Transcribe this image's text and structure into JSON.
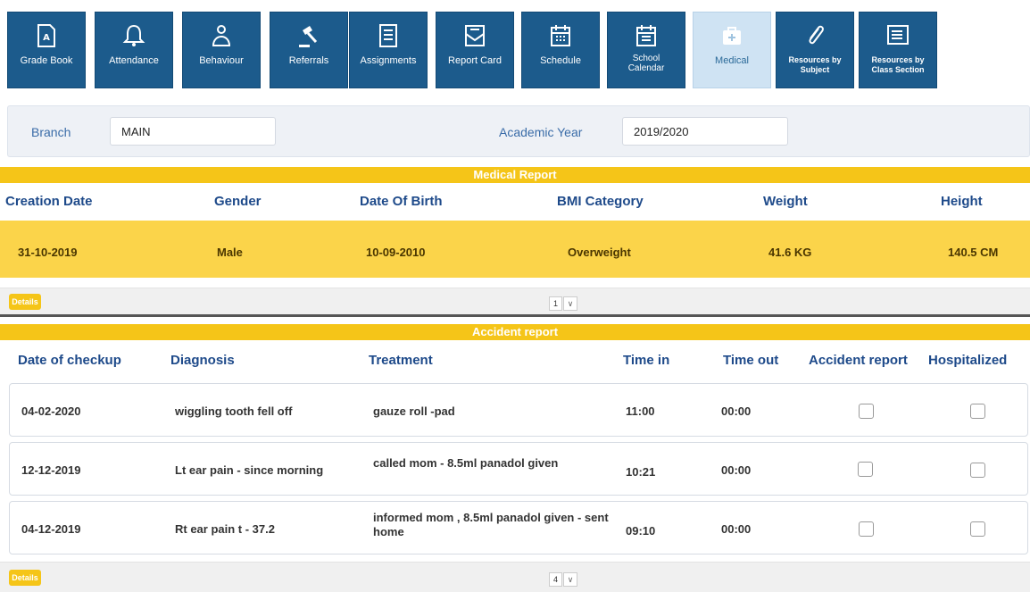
{
  "toolbar": {
    "tiles": [
      {
        "label": "Grade Book"
      },
      {
        "label": "Attendance"
      },
      {
        "label": "Behaviour"
      },
      {
        "label": "Referrals"
      },
      {
        "label": "Assignments"
      },
      {
        "label": "Report Card"
      },
      {
        "label": "Schedule"
      },
      {
        "label": "School Calendar"
      },
      {
        "label": "Medical"
      },
      {
        "label": "Resources by Subject"
      },
      {
        "label": "Resources by Class Section"
      }
    ]
  },
  "filter": {
    "branch_label": "Branch",
    "branch_value": "MAIN",
    "year_label": "Academic Year",
    "year_value": "2019/2020"
  },
  "medical": {
    "title": "Medical Report",
    "columns": [
      "Creation Date",
      "Gender",
      "Date Of Birth",
      "BMI Category",
      "Weight",
      "Height"
    ],
    "row": [
      "31-10-2019",
      "Male",
      "10-09-2010",
      "Overweight",
      "41.6 KG",
      "140.5 CM"
    ],
    "details_label": "Details",
    "page": "1"
  },
  "accident": {
    "title": "Accident report",
    "columns": [
      "Date of checkup",
      "Diagnosis",
      "Treatment",
      "Time in",
      "Time out",
      "Accident report",
      "Hospitalized"
    ],
    "rows": [
      {
        "date": "04-02-2020",
        "diagnosis": "wiggling tooth fell off",
        "treatment": "gauze roll -pad",
        "time_in": "11:00",
        "time_out": "00:00"
      },
      {
        "date": "12-12-2019",
        "diagnosis": "Lt ear pain - since morning",
        "treatment": "called mom - 8.5ml panadol given",
        "time_in": "10:21",
        "time_out": "00:00"
      },
      {
        "date": "04-12-2019",
        "diagnosis": "Rt ear pain t - 37.2",
        "treatment": "informed mom , 8.5ml panadol given - sent home",
        "time_in": "09:10",
        "time_out": "00:00"
      }
    ],
    "details_label": "Details",
    "page": "4"
  },
  "colors": {
    "tile": "#1c5b8c",
    "tile_active": "#cfe3f3",
    "accent": "#f5c518",
    "row_highlight": "#fbd44a"
  }
}
